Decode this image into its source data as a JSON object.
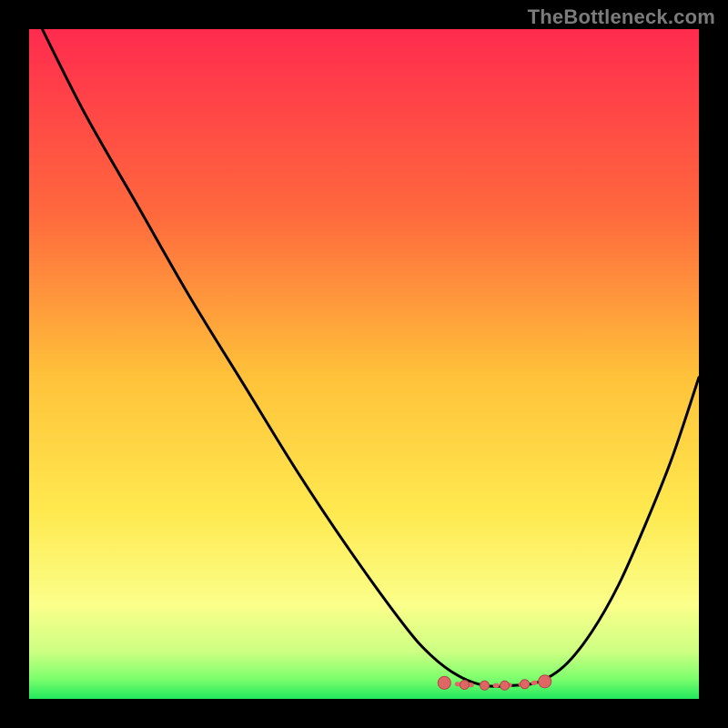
{
  "watermark": "TheBottleneck.com",
  "colors": {
    "bg": "#000000",
    "grad_top": "#ff2b4e",
    "grad_mid_upper": "#ff8a3a",
    "grad_mid": "#ffd23a",
    "grad_mid_lower": "#fff773",
    "grad_green_light": "#b6ff7a",
    "grad_green": "#2cff66",
    "curve": "#000000",
    "marker_fill": "#e06666",
    "marker_stroke": "#b34747"
  },
  "chart_data": {
    "type": "line",
    "title": "",
    "xlabel": "",
    "ylabel": "",
    "xlim": [
      0,
      100
    ],
    "ylim": [
      0,
      100
    ],
    "series": [
      {
        "name": "bottleneck-curve",
        "x": [
          0,
          8,
          16,
          24,
          32,
          40,
          48,
          56,
          60,
          64,
          68,
          72,
          76,
          80,
          84,
          88,
          92,
          96,
          100
        ],
        "y": [
          104,
          88,
          74,
          60,
          47,
          34,
          22,
          11,
          6.5,
          3.5,
          2,
          2,
          2.5,
          5,
          10,
          17,
          26,
          36,
          48
        ]
      }
    ],
    "markers": [
      {
        "x": 62,
        "y": 2.4
      },
      {
        "x": 65,
        "y": 2.1
      },
      {
        "x": 68,
        "y": 2.0
      },
      {
        "x": 71,
        "y": 2.0
      },
      {
        "x": 74,
        "y": 2.2
      },
      {
        "x": 77,
        "y": 2.6
      }
    ],
    "description": "Bottleneck curve with a V shape; minimum near x≈70, right branch rising to ~48% at x=100; left branch rising off the top of the chart near x=0. Background gradient runs from green (0% bottleneck) at bottom through yellow/orange to red (100% bottleneck) at top.",
    "grid": false,
    "axis_ticks_visible": false
  }
}
